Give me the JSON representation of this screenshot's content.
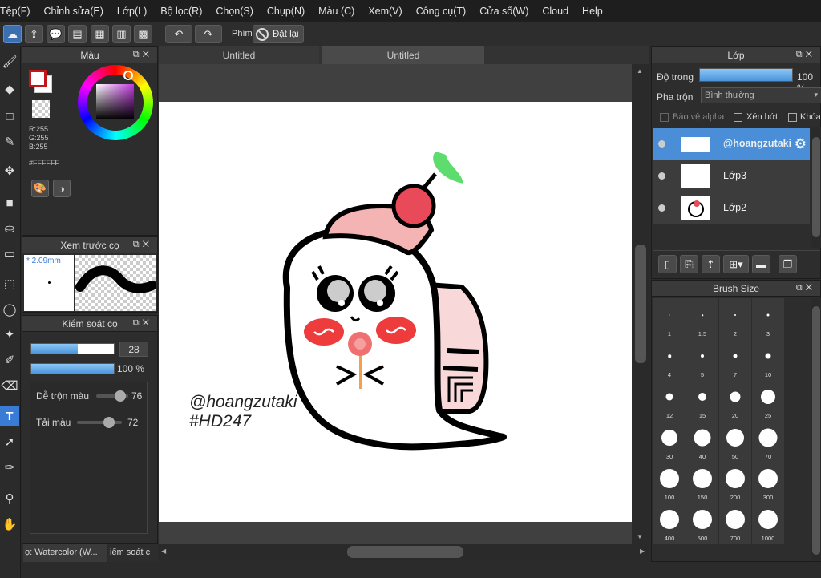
{
  "menu": [
    "Tệp(F)",
    "Chỉnh sửa(E)",
    "Lớp(L)",
    "Bộ lọc(R)",
    "Chọn(S)",
    "Chụp(N)",
    "Màu (C)",
    "Xem(V)",
    "Công cụ(T)",
    "Cửa sổ(W)",
    "Cloud",
    "Help"
  ],
  "toolbar": {
    "shortcut_label": "Phím",
    "reset_label": "Đặt lại"
  },
  "color_panel": {
    "title": "Màu",
    "r": "R:255",
    "g": "G:255",
    "b": "B:255",
    "hex": "#FFFFFF",
    "fg_color": "#ffffff",
    "accent": "#c01818"
  },
  "preview_panel": {
    "title": "Xem trước cọ",
    "size": "* 2.09mm"
  },
  "brush_control": {
    "title": "Kiểm soát cọ",
    "size_value": "28",
    "size_fraction": 0.56,
    "opacity_value": "100 %",
    "opacity_fraction": 1.0,
    "blend_label": "Dễ trộn màu",
    "blend_value": "76",
    "blend_fraction": 0.76,
    "paint_label": "Tải màu",
    "paint_value": "72",
    "paint_fraction": 0.72
  },
  "bottom_tabs": [
    "ọ: Watercolor (W...",
    "iểm soát c"
  ],
  "tabs": [
    "Untitled",
    "Untitled"
  ],
  "artwork": {
    "handle": "@hoangzutaki",
    "tag": "#HD247"
  },
  "layer_panel": {
    "title": "Lớp",
    "opacity_label": "Độ trong",
    "opacity_value": "100 %",
    "opacity_fraction": 1.0,
    "blend_label": "Pha trộn",
    "blend_value": "Bình thường",
    "protect_alpha": "Bảo vệ alpha",
    "clipping": "Xén bớt",
    "lock": "Khóa",
    "layers": [
      {
        "name": "@hoangzutaki",
        "selected": true
      },
      {
        "name": "Lớp3",
        "selected": false
      },
      {
        "name": "Lớp2",
        "selected": false
      }
    ]
  },
  "brush_size_panel": {
    "title": "Brush Size",
    "sizes": [
      "1",
      "1.5",
      "2",
      "3",
      "4",
      "5",
      "7",
      "10",
      "12",
      "15",
      "20",
      "25",
      "30",
      "40",
      "50",
      "70",
      "100",
      "150",
      "200",
      "300",
      "400",
      "500",
      "700",
      "1000"
    ]
  }
}
